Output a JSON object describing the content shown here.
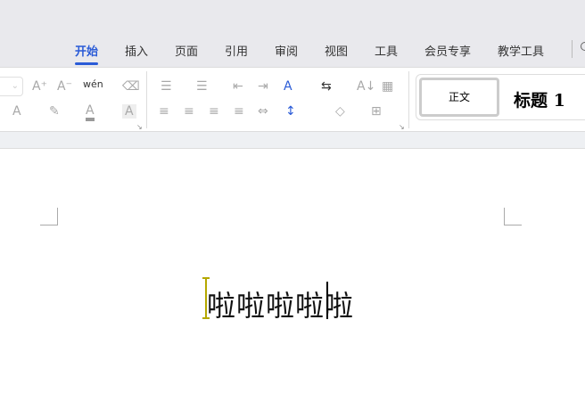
{
  "tabs": [
    "开始",
    "插入",
    "页面",
    "引用",
    "审阅",
    "视图",
    "工具",
    "会员专享",
    "教学工具"
  ],
  "active_tab": "开始",
  "toolbar": {
    "grow_font": "A⁺",
    "shrink_font": "A⁻",
    "phonetic": "wén",
    "clear_format": "⌫",
    "text_effect": "A",
    "highlight": "✎",
    "font_color": "A",
    "char_shading": "A",
    "bullets": "☰",
    "numbering": "☰",
    "outdent": "⇤",
    "indent": "⇥",
    "text_direction": "A",
    "convert": "⇆",
    "sort": "A↓",
    "table": "▦",
    "align_left": "≡",
    "align_center": "≡",
    "align_right": "≡",
    "justify": "≡",
    "distribute": "⇔",
    "line_spacing": "↕",
    "fill": "◇",
    "border": "⊞"
  },
  "styles": {
    "body": "正文",
    "heading1": "标题 1"
  },
  "document": {
    "text": "啦啦啦啦啦"
  }
}
